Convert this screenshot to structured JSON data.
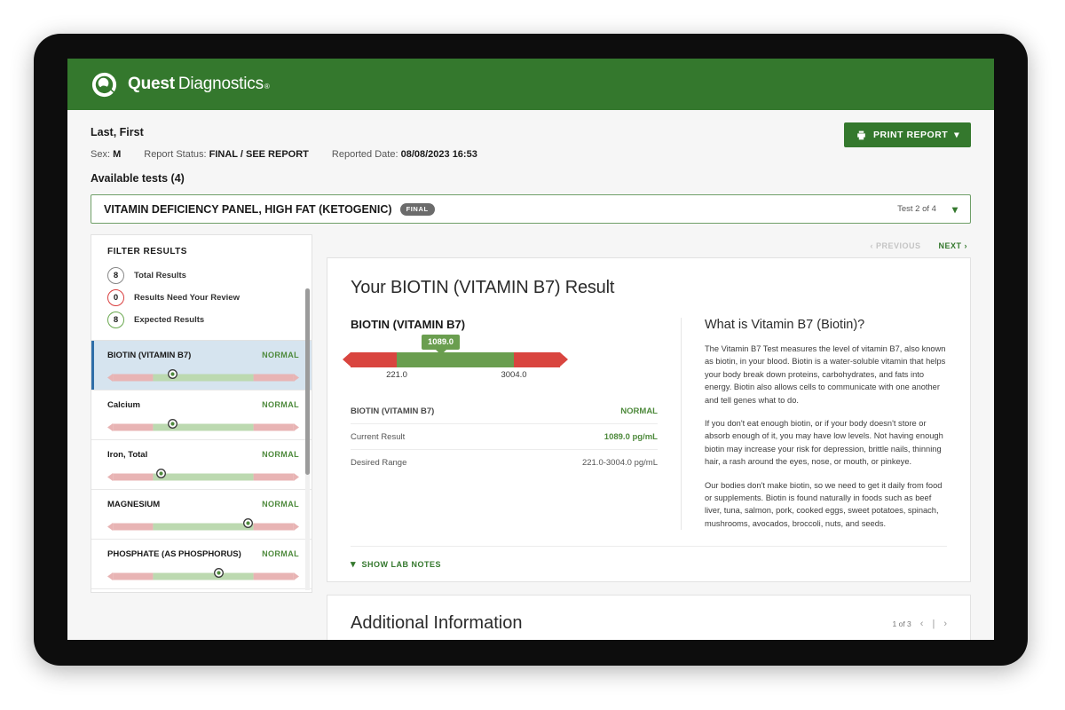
{
  "brand": {
    "name_bold": "Quest",
    "name_light": "Diagnostics",
    "trademark": "®",
    "logo_icon": "quest-swoosh-logo",
    "color": "#34782d"
  },
  "patient": {
    "name": "Last, First",
    "sex_label": "Sex:",
    "sex_value": "M",
    "report_status_label": "Report Status:",
    "report_status_value": "FINAL / SEE REPORT",
    "reported_date_label": "Reported Date:",
    "reported_date_value": "08/08/2023 16:53",
    "available_tests": "Available tests (4)"
  },
  "toolbar": {
    "print_label": "PRINT REPORT",
    "print_icon": "printer-icon",
    "print_chevron_icon": "chevron-down-icon"
  },
  "test_selector": {
    "title": "VITAMIN DEFICIENCY PANEL, HIGH FAT (KETOGENIC)",
    "badge": "FINAL",
    "counter": "Test 2 of 4",
    "chevron_icon": "chevron-down-icon"
  },
  "sidebar": {
    "heading": "FILTER RESULTS",
    "filters": [
      {
        "count": "8",
        "label": "Total Results",
        "style": "grey"
      },
      {
        "count": "0",
        "label": "Results Need Your Review",
        "style": "red"
      },
      {
        "count": "8",
        "label": "Expected Results",
        "style": "green"
      }
    ],
    "results": [
      {
        "name": "BIOTIN (VITAMIN B7)",
        "status": "NORMAL",
        "marker_pct": 34,
        "active": true
      },
      {
        "name": "Calcium",
        "status": "NORMAL",
        "marker_pct": 34,
        "active": false
      },
      {
        "name": "Iron, Total",
        "status": "NORMAL",
        "marker_pct": 28,
        "active": false
      },
      {
        "name": "MAGNESIUM",
        "status": "NORMAL",
        "marker_pct": 73,
        "active": false
      },
      {
        "name": "PHOSPHATE (AS PHOSPHORUS)",
        "status": "NORMAL",
        "marker_pct": 58,
        "active": false
      }
    ]
  },
  "pager": {
    "previous": "PREVIOUS",
    "next": "NEXT",
    "prev_icon": "chevron-left-icon",
    "next_icon": "chevron-right-icon"
  },
  "result_card": {
    "title": "Your BIOTIN (VITAMIN B7) Result",
    "analyte": "BIOTIN (VITAMIN B7)",
    "status": "NORMAL",
    "current_result_label": "Current Result",
    "current_result_value": "1089.0 pg/mL",
    "desired_range_label": "Desired Range",
    "desired_range_value": "221.0-3004.0 pg/mL",
    "lab_notes_label": "SHOW LAB NOTES",
    "lab_notes_icon": "chevron-down-icon"
  },
  "chart_data": {
    "type": "bar",
    "title": "BIOTIN (VITAMIN B7) reference range gauge",
    "value": 1089.0,
    "value_label": "1089.0",
    "unit": "pg/mL",
    "range_low": 221.0,
    "range_high": 3004.0,
    "tick_labels": [
      "221.0",
      "3004.0"
    ],
    "marker_pct": 46,
    "segments": [
      {
        "name": "below range",
        "color": "#d9453f"
      },
      {
        "name": "normal range",
        "color": "#6a9e4f"
      },
      {
        "name": "above range",
        "color": "#d9453f"
      }
    ]
  },
  "info_panel": {
    "heading": "What is Vitamin B7 (Biotin)?",
    "paragraphs": [
      "The Vitamin B7 Test measures the level of vitamin B7, also known as biotin, in your blood. Biotin is a water-soluble vitamin that helps your body break down proteins, carbohydrates, and fats into energy. Biotin also allows cells to communicate with one another and tell genes what to do.",
      "If you don't eat enough biotin, or if your body doesn't store or absorb enough of it, you may have low levels. Not having enough biotin may increase your risk for depression, brittle nails, thinning hair, a rash around the eyes, nose, or mouth, or pinkeye.",
      "Our bodies don't make biotin, so we need to get it daily from food or supplements. Biotin is found naturally in foods such as beef liver, tuna, salmon, pork, cooked eggs, sweet potatoes, spinach, mushrooms, avocados, broccoli, nuts, and seeds."
    ]
  },
  "additional": {
    "heading": "Additional Information",
    "page_counter": "1 of 3",
    "prev_icon": "chevron-left-icon",
    "divider": "|",
    "next_icon": "chevron-right-icon"
  }
}
